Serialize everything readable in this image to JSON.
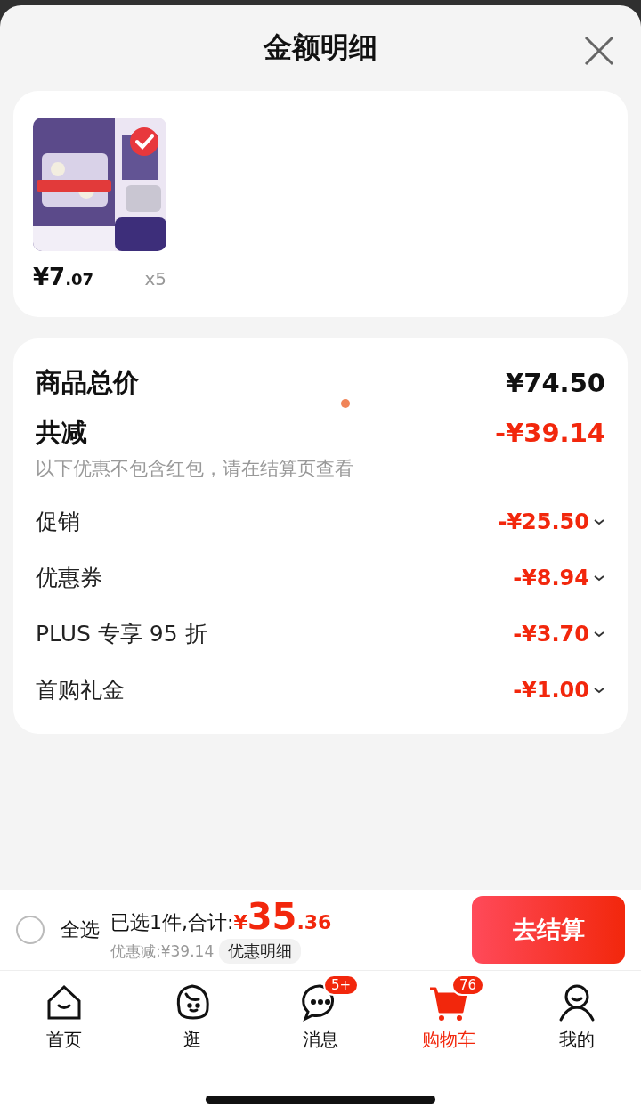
{
  "header": {
    "title": "金额明细"
  },
  "product": {
    "selected": true,
    "price_main": "¥7",
    "price_decimal": ".07",
    "quantity": "x5"
  },
  "summary": {
    "total_label": "商品总价",
    "total_value": "¥74.50",
    "discount_label": "共减",
    "discount_value": "-¥39.14",
    "note": "以下优惠不包含红包，请在结算页查看",
    "items": [
      {
        "label": "促销",
        "value": "-¥25.50"
      },
      {
        "label": "优惠券",
        "value": "-¥8.94"
      },
      {
        "label": "PLUS 专享 95 折",
        "value": "-¥3.70"
      },
      {
        "label": "首购礼金",
        "value": "-¥1.00"
      }
    ]
  },
  "checkout": {
    "select_all": {
      "label": "全选",
      "checked": false
    },
    "selected_text": "已选1件,合计:",
    "currency": "¥",
    "amount_main": "35",
    "amount_decimal": ".36",
    "saved": "优惠减:¥39.14",
    "details_button": "优惠明细",
    "submit": "去结算"
  },
  "tabs": [
    {
      "label": "首页",
      "kind": "home",
      "selected": false
    },
    {
      "label": "逛",
      "kind": "face",
      "selected": false
    },
    {
      "label": "消息",
      "kind": "chat",
      "selected": false,
      "badge": "5+"
    },
    {
      "label": "购物车",
      "kind": "cart",
      "selected": true,
      "badge": "76"
    },
    {
      "label": "我的",
      "kind": "user",
      "selected": false
    }
  ]
}
